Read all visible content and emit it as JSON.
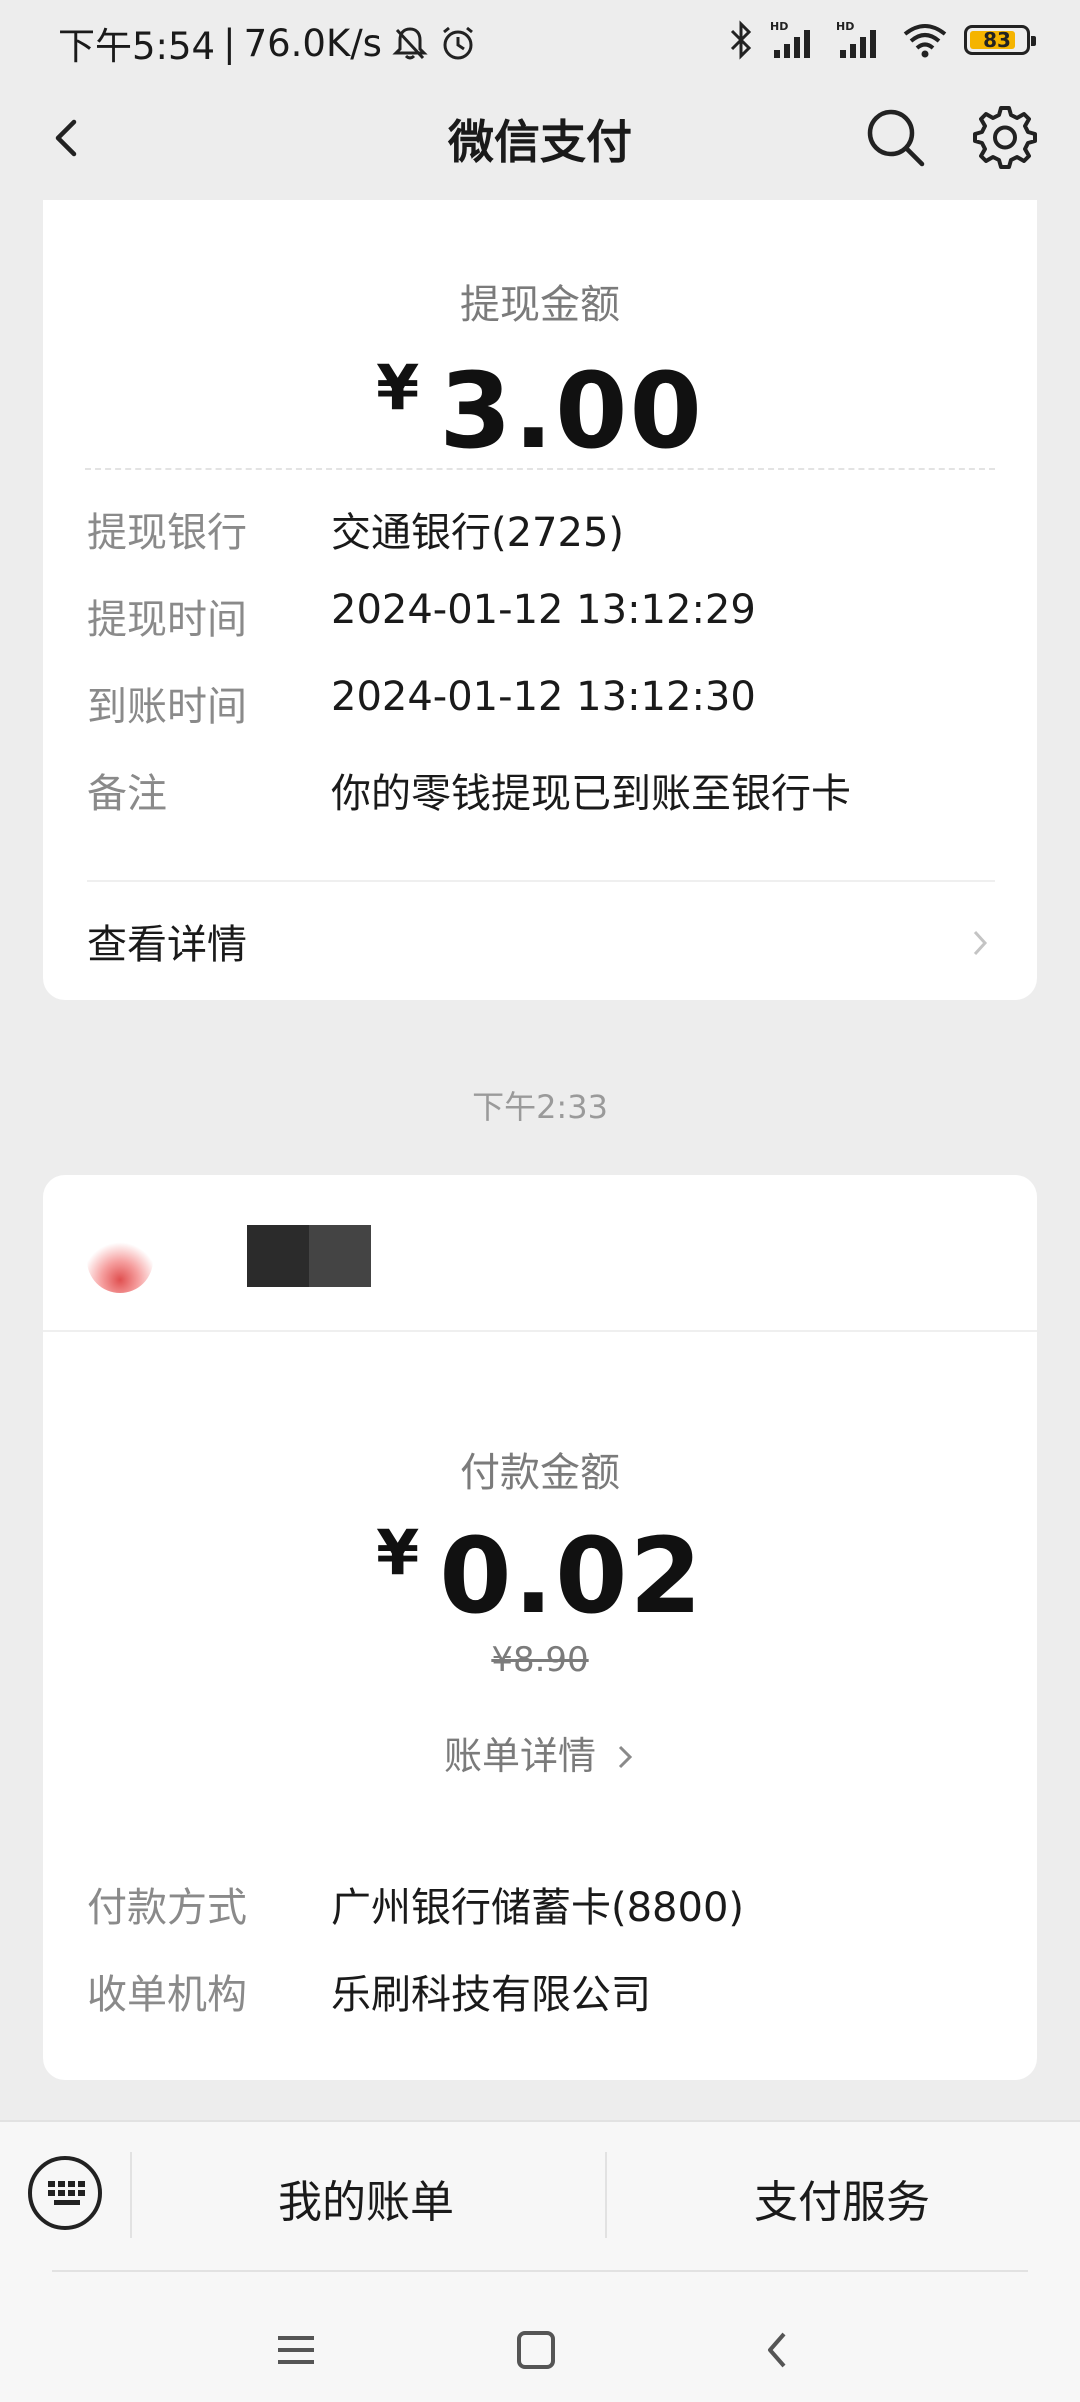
{
  "status_bar": {
    "time": "下午5:54",
    "net_speed": "76.0K/s",
    "battery": "83",
    "battery_fraction": 0.83,
    "icons": [
      "bell-off-icon",
      "alarm-icon",
      "bluetooth-icon",
      "signal-hd-icon",
      "signal-hd-icon",
      "wifi-icon",
      "battery-icon"
    ]
  },
  "header": {
    "title": "微信支付",
    "icons": [
      "back-icon",
      "search-icon",
      "gear-icon"
    ]
  },
  "withdraw_card": {
    "amount_label": "提现金额",
    "currency": "¥",
    "amount": "3.00",
    "rows": [
      {
        "key": "提现银行",
        "value": "交通银行(2725)"
      },
      {
        "key": "提现时间",
        "value": "2024-01-12 13:12:29"
      },
      {
        "key": "到账时间",
        "value": "2024-01-12 13:12:30"
      },
      {
        "key": "备注",
        "value": "你的零钱提现已到账至银行卡"
      }
    ],
    "detail_link": "查看详情"
  },
  "time_separator": "下午2:33",
  "payment_card": {
    "amount_label": "付款金额",
    "currency": "¥",
    "amount": "0.02",
    "original_price": "¥8.90",
    "bill_link": "账单详情",
    "rows": [
      {
        "key": "付款方式",
        "value": "广州银行储蓄卡(8800)"
      },
      {
        "key": "收单机构",
        "value": "乐刷科技有限公司"
      }
    ]
  },
  "bottom_tabs": {
    "left": "我的账单",
    "right": "支付服务"
  },
  "colors": {
    "background": "#ededed",
    "card": "#ffffff",
    "battery_fill": "#f5b400",
    "muted_text": "#8a8a8a"
  }
}
